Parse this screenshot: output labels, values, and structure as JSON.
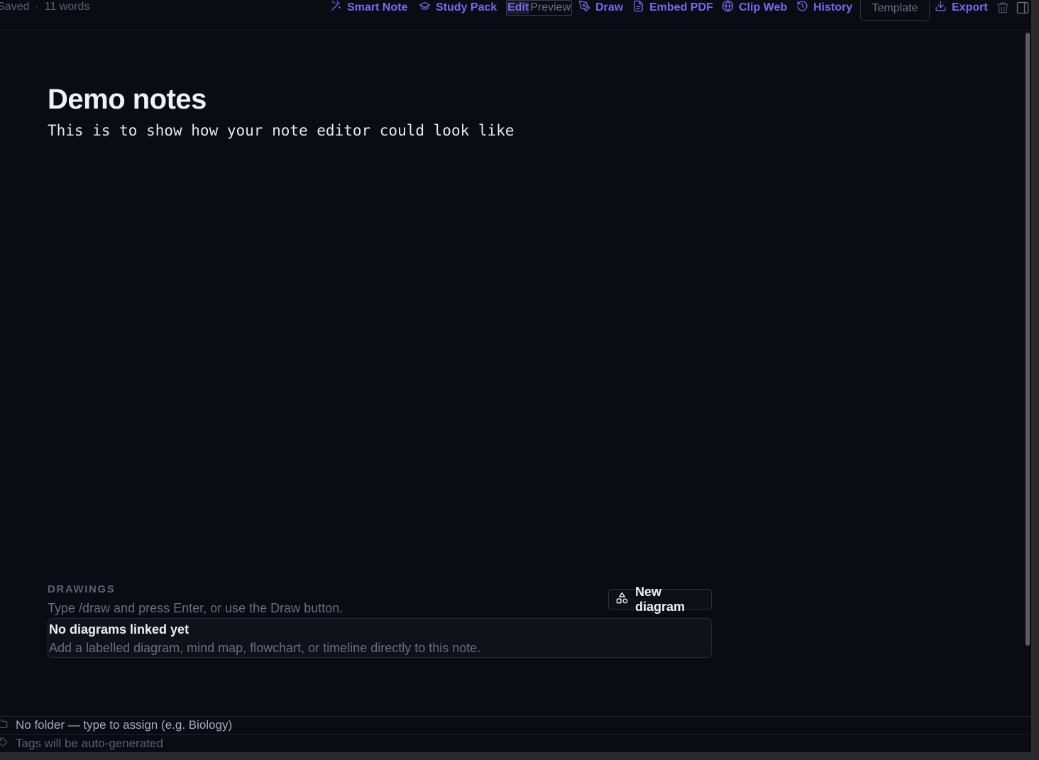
{
  "status": {
    "saved": "Saved",
    "separator": "·",
    "word_count": "11 words"
  },
  "toolbar": {
    "smart_note": "Smart Note",
    "study_pack": "Study Pack",
    "mode_edit": "Edit",
    "mode_preview": "Preview",
    "active_mode": "Edit",
    "draw": "Draw",
    "embed_pdf": "Embed PDF",
    "clip_web": "Clip Web",
    "history": "History",
    "template": "Template",
    "export": "Export"
  },
  "note": {
    "title": "Demo notes",
    "body": "This is to show how your note editor could look like"
  },
  "drawings": {
    "section_label": "DRAWINGS",
    "hint": "Type /draw and press Enter, or use the Draw button.",
    "new_diagram": "New diagram",
    "empty_title": "No diagrams linked yet",
    "empty_description": "Add a labelled diagram, mind map, flowchart, or timeline directly to this note."
  },
  "meta": {
    "folder_placeholder": "No folder — type to assign (e.g. Biology)",
    "tags_placeholder": "Tags will be auto-generated"
  },
  "colors": {
    "accent": "#7c66f0",
    "background": "#0a0c13",
    "text": "#f1f2f6",
    "muted": "#5d6170"
  },
  "icons": [
    "magic-wand-icon",
    "graduation-cap-icon",
    "pen-icon",
    "file-icon",
    "globe-icon",
    "history-icon",
    "download-icon",
    "trash-icon",
    "sidebar-toggle-icon",
    "shapes-icon",
    "folder-icon",
    "tag-icon"
  ]
}
